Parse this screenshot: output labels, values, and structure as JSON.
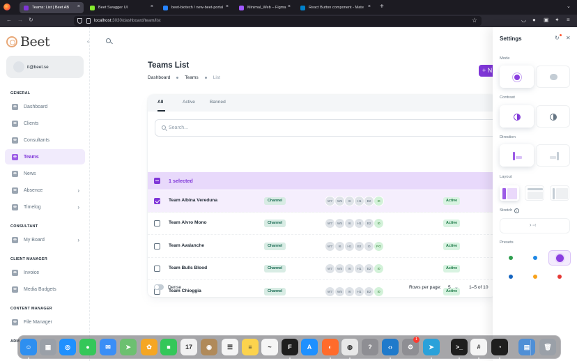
{
  "browser": {
    "tabs": [
      {
        "title": "Teams: List | Beet AB",
        "active": true,
        "favicon_color": "#7f36d8"
      },
      {
        "title": "Beet Swagger UI",
        "active": false,
        "favicon_color": "#85ea2d"
      },
      {
        "title": "beet-biotech / new-beet-portal",
        "active": false,
        "favicon_color": "#2684ff"
      },
      {
        "title": "Minimal_Web – Figma",
        "active": false,
        "favicon_color": "#a259ff"
      },
      {
        "title": "React Button component - Mate",
        "active": false,
        "favicon_color": "#0081cb"
      }
    ],
    "new_tab_icon": "plus-icon",
    "url_host": "localhost",
    "url_path": ":3030/dashboard/team/list"
  },
  "app": {
    "brand": "Beet",
    "account_email": "it@beet.se",
    "accent_color": "#7f36d8",
    "sidebar": {
      "sections": [
        {
          "header": "GENERAL",
          "items": [
            {
              "label": "Dashboard",
              "icon": "dashboard-icon",
              "active": false,
              "chevron": false
            },
            {
              "label": "Clients",
              "icon": "clients-icon",
              "active": false,
              "chevron": false
            },
            {
              "label": "Consultants",
              "icon": "consultants-icon",
              "active": false,
              "chevron": false
            },
            {
              "label": "Teams",
              "icon": "teams-icon",
              "active": true,
              "chevron": false
            },
            {
              "label": "News",
              "icon": "news-icon",
              "active": false,
              "chevron": false
            },
            {
              "label": "Absence",
              "icon": "absence-icon",
              "active": false,
              "chevron": true
            },
            {
              "label": "Timelog",
              "icon": "timelog-icon",
              "active": false,
              "chevron": true
            }
          ]
        },
        {
          "header": "CONSULTANT",
          "items": [
            {
              "label": "My Board",
              "icon": "board-icon",
              "active": false,
              "chevron": true
            }
          ]
        },
        {
          "header": "CLIENT MANAGER",
          "items": [
            {
              "label": "Invoice",
              "icon": "invoice-icon",
              "active": false,
              "chevron": false
            },
            {
              "label": "Media Budgets",
              "icon": "budgets-icon",
              "active": false,
              "chevron": false
            }
          ]
        },
        {
          "header": "CONTENT MANAGER",
          "items": [
            {
              "label": "File Manager",
              "icon": "file-manager-icon",
              "active": false,
              "chevron": false
            }
          ]
        },
        {
          "header": "ADM",
          "items": []
        }
      ]
    },
    "page": {
      "title": "Teams List",
      "breadcrumbs": [
        "Dashboard",
        "Teams",
        "List"
      ],
      "new_button_label": "+ N"
    },
    "list": {
      "filter_tabs": [
        "All",
        "Active",
        "Banned"
      ],
      "active_tab": "All",
      "search_placeholder": "Search...",
      "selected_text": "1 selected",
      "rows": [
        {
          "name": "Team Albina Vereduna",
          "type": "Channel",
          "members": [
            "W7",
            "W5",
            "I6",
            "H1",
            "B2",
            "I0"
          ],
          "status": "Active",
          "selected": true
        },
        {
          "name": "Team Alvro Mono",
          "type": "Channel",
          "members": [
            "W7",
            "W5",
            "I6",
            "H1",
            "B2",
            "I0"
          ],
          "status": "Active",
          "selected": false
        },
        {
          "name": "Team Avalanche",
          "type": "Channel",
          "members": [
            "W7",
            "I6",
            "H1",
            "B2",
            "I0",
            "PG"
          ],
          "status": "Active",
          "selected": false
        },
        {
          "name": "Team Bulls Blood",
          "type": "Channel",
          "members": [
            "W7",
            "W5",
            "I6",
            "H1",
            "B2",
            "I0"
          ],
          "status": "Active",
          "selected": false
        },
        {
          "name": "Team Chioggia",
          "type": "Channel",
          "members": [
            "W7",
            "W5",
            "I6",
            "H1",
            "B2",
            "I0"
          ],
          "status": "Active",
          "selected": false
        }
      ],
      "dense_label": "Dense",
      "rows_per_page_label": "Rows per page:",
      "rows_per_page": "5",
      "range_label": "1–5 of 10"
    },
    "settings": {
      "title": "Settings",
      "mode_label": "Mode",
      "contrast_label": "Contrast",
      "direction_label": "Direction",
      "layout_label": "Layout",
      "stretch_label": "Stretch",
      "presets_label": "Presets",
      "presets": [
        {
          "color": "#2e9e4f",
          "selected": false
        },
        {
          "color": "#1e88e5",
          "selected": false
        },
        {
          "color": "#8a3ee0",
          "selected": true
        },
        {
          "color": "#1565c0",
          "selected": false
        },
        {
          "color": "#f7a21b",
          "selected": false
        },
        {
          "color": "#e53935",
          "selected": false
        }
      ]
    }
  },
  "dock": {
    "apps": [
      {
        "name": "Finder",
        "icon": "finder-icon",
        "color": "#2e8ff0",
        "glyph": "☺",
        "running": true
      },
      {
        "name": "Launchpad",
        "icon": "launchpad-icon",
        "color": "#9aa0a8",
        "glyph": "▦",
        "running": false
      },
      {
        "name": "Safari",
        "icon": "safari-icon",
        "color": "#1e90ff",
        "glyph": "◎",
        "running": false
      },
      {
        "name": "Messages",
        "icon": "messages-icon",
        "color": "#34c759",
        "glyph": "●",
        "running": false
      },
      {
        "name": "Mail",
        "icon": "mail-icon",
        "color": "#3a8ef6",
        "glyph": "✉",
        "running": false
      },
      {
        "name": "Maps",
        "icon": "maps-icon",
        "color": "#6cc070",
        "glyph": "➤",
        "running": false
      },
      {
        "name": "Photos",
        "icon": "photos-icon",
        "color": "#f5a623",
        "glyph": "✿",
        "running": false
      },
      {
        "name": "FaceTime",
        "icon": "facetime-icon",
        "color": "#34c759",
        "glyph": "■",
        "running": false
      },
      {
        "name": "Calendar",
        "icon": "calendar-icon",
        "color": "#f2f2f2",
        "glyph": "17",
        "running": false
      },
      {
        "name": "Contacts",
        "icon": "contacts-icon",
        "color": "#b08a5a",
        "glyph": "◉",
        "running": false
      },
      {
        "name": "Reminders",
        "icon": "reminders-icon",
        "color": "#f5f5f5",
        "glyph": "☰",
        "running": false
      },
      {
        "name": "Notes",
        "icon": "notes-icon",
        "color": "#fcd34d",
        "glyph": "≡",
        "running": false
      },
      {
        "name": "Freeform",
        "icon": "freeform-icon",
        "color": "#f5f5f5",
        "glyph": "~",
        "running": false
      },
      {
        "name": "Figma",
        "icon": "figma-icon",
        "color": "#1e1e1e",
        "glyph": "F",
        "running": true
      },
      {
        "name": "App Store",
        "icon": "app-store-icon",
        "color": "#1e90ff",
        "glyph": "A",
        "running": false
      },
      {
        "name": "Firefox",
        "icon": "firefox-icon",
        "color": "#ff6b2b",
        "glyph": "◐",
        "running": true
      },
      {
        "name": "Chrome",
        "icon": "chrome-icon",
        "color": "#e8e8e8",
        "glyph": "◍",
        "running": true
      },
      {
        "name": "Help",
        "icon": "help-icon",
        "color": "#8e8e93",
        "glyph": "?",
        "running": false
      },
      {
        "name": "VS Code",
        "icon": "vscode-icon",
        "color": "#1f7acb",
        "glyph": "‹›",
        "running": true
      },
      {
        "name": "System Settings",
        "icon": "system-settings-icon",
        "color": "#8e8e93",
        "glyph": "⚙",
        "running": false,
        "badge": "1"
      },
      {
        "name": "Telegram",
        "icon": "telegram-icon",
        "color": "#2aa1da",
        "glyph": "➤",
        "running": true
      },
      {
        "name": "Terminal",
        "icon": "terminal-icon",
        "color": "#1e1e1e",
        "glyph": ">_",
        "running": true
      },
      {
        "name": "Slack",
        "icon": "slack-icon",
        "color": "#f5f5f5",
        "glyph": "#",
        "running": true
      },
      {
        "name": "Clock",
        "icon": "clock-icon",
        "color": "#1e1e1e",
        "glyph": "◔",
        "running": true
      },
      {
        "name": "Downloads",
        "icon": "downloads-folder-icon",
        "color": "#4f8fd6",
        "glyph": "▤",
        "running": false
      },
      {
        "name": "Trash",
        "icon": "trash-icon",
        "color": "#9aa0a8",
        "glyph": "🗑",
        "running": false
      }
    ]
  }
}
